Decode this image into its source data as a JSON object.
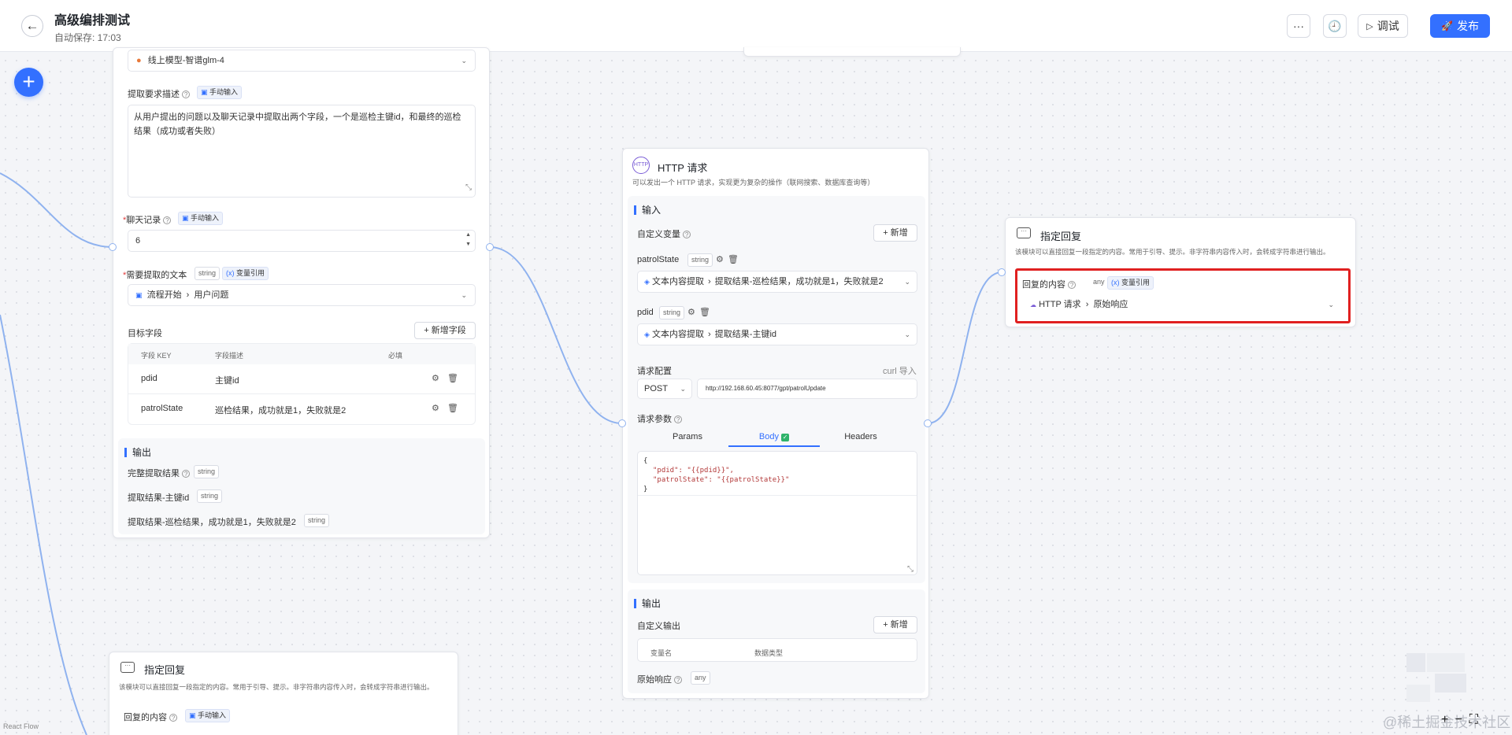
{
  "header": {
    "title": "高级编排测试",
    "autosave": "自动保存: 17:03",
    "debug_label": "调试",
    "publish_label": "发布"
  },
  "extract_node": {
    "model_select": "线上模型-智谱glm-4",
    "desc_label": "提取要求描述",
    "manual_input": "手动输入",
    "desc_text": "从用户提出的问题以及聊天记录中提取出两个字段，一个是巡检主键id，和最终的巡检结果（成功或者失败）",
    "history_label": "聊天记录",
    "history_value": "6",
    "text_label": "需要提取的文本",
    "string_tag": "string",
    "var_ref": "变量引用",
    "text_ref_node": "流程开始",
    "text_ref_field": "用户问题",
    "target_label": "目标字段",
    "add_field": "+ 新增字段",
    "col_key": "字段 KEY",
    "col_desc": "字段描述",
    "col_required": "必填",
    "rows": [
      {
        "key": "pdid",
        "desc": "主键id"
      },
      {
        "key": "patrolState",
        "desc": "巡检结果，成功就是1，失败就是2"
      }
    ],
    "output_title": "输出",
    "outputs": [
      {
        "name": "完整提取结果",
        "type": "string"
      },
      {
        "name": "提取结果-主键id",
        "type": "string"
      },
      {
        "name": "提取结果-巡检结果，成功就是1，失败就是2",
        "type": "string"
      }
    ]
  },
  "http_node": {
    "title": "HTTP 请求",
    "desc": "可以发出一个 HTTP 请求，实现更为复杂的操作（联网搜索、数据库查询等）",
    "input_title": "输入",
    "custom_var": "自定义变量",
    "add": "+ 新增",
    "var1_name": "patrolState",
    "var1_type": "string",
    "var1_ref_node": "文本内容提取",
    "var1_ref_field": "提取结果-巡检结果，成功就是1，失败就是2",
    "var2_name": "pdid",
    "var2_type": "string",
    "var2_ref_node": "文本内容提取",
    "var2_ref_field": "提取结果-主键id",
    "req_config": "请求配置",
    "curl_import": "curl 导入",
    "method": "POST",
    "url": "http://192.168.60.45:8077/gpt/patrolUpdate",
    "req_params": "请求参数",
    "tab_params": "Params",
    "tab_body": "Body",
    "tab_headers": "Headers",
    "body_lines": [
      "{",
      "\"pdid\": \"{{pdid}}\",",
      "\"patrolState\": \"{{patrolState}}\"",
      "}"
    ],
    "output_title": "输出",
    "custom_output": "自定义输出",
    "col_var": "变量名",
    "col_type": "数据类型",
    "raw_resp": "原始响应",
    "any_tag": "any"
  },
  "reply_node_right": {
    "title": "指定回复",
    "desc": "该模块可以直接回复一段指定的内容。常用于引导、提示。非字符串内容传入时，会转成字符串进行输出。",
    "content_label": "回复的内容",
    "any_tag": "any",
    "var_ref": "变量引用",
    "ref_node": "HTTP 请求",
    "ref_field": "原始响应"
  },
  "reply_node_bottom": {
    "title": "指定回复",
    "desc": "该模块可以直接回复一段指定的内容。常用于引导、提示。非字符串内容传入时，会转成字符串进行输出。",
    "content_label": "回复的内容",
    "manual_input": "手动输入"
  },
  "footer": {
    "react_flow": "React Flow",
    "watermark": "@稀土掘金技术社区"
  },
  "colors": {
    "accent": "#3370ff",
    "highlight": "#e02020",
    "edge": "#8fb2ef"
  }
}
